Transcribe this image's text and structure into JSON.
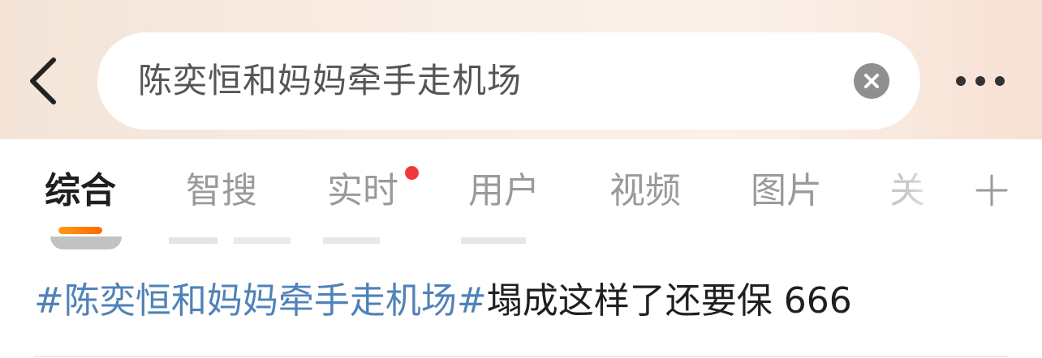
{
  "search": {
    "query": "陈奕恒和妈妈牵手走机场"
  },
  "tabs": [
    {
      "label": "综合",
      "active": true
    },
    {
      "label": "智搜"
    },
    {
      "label": "实时",
      "has_dot": true
    },
    {
      "label": "用户"
    },
    {
      "label": "视频"
    },
    {
      "label": "图片"
    },
    {
      "label": "关"
    }
  ],
  "post": {
    "hashtag": "#陈奕恒和妈妈牵手走机场#",
    "text": "塌成这样了还要保 666"
  },
  "icons": {
    "back": "chevron-left-icon",
    "clear": "close-circle-icon",
    "more": "more-horizontal-icon",
    "add": "plus-icon"
  },
  "colors": {
    "tab_indicator": "#ff8a00",
    "hashtag": "#4f82b8",
    "notification_dot": "#f2393a"
  }
}
